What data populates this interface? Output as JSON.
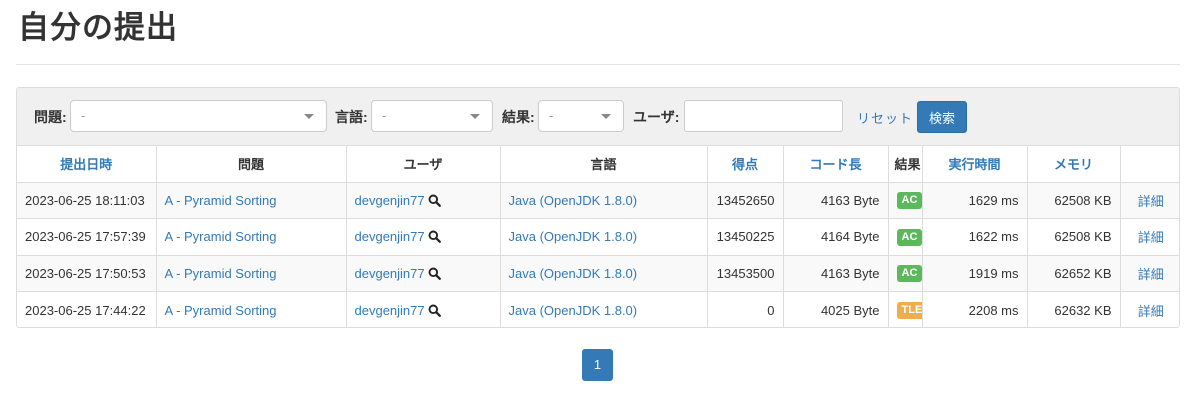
{
  "page": {
    "title": "自分の提出"
  },
  "filters": {
    "task_label": "問題:",
    "task_value": "-",
    "language_label": "言語:",
    "language_value": "-",
    "status_label": "結果:",
    "status_value": "-",
    "user_label": "ユーザ:",
    "user_value": "",
    "reset_label": "リセット",
    "search_label": "検索"
  },
  "table": {
    "headers": {
      "submit_time": "提出日時",
      "task": "問題",
      "user": "ユーザ",
      "language": "言語",
      "score": "得点",
      "code_length": "コード長",
      "status": "結果",
      "exec_time": "実行時間",
      "memory": "メモリ",
      "detail": ""
    },
    "rows": [
      {
        "submit_time": "2023-06-25 18:11:03",
        "task": "A - Pyramid Sorting",
        "user": "devgenjin77",
        "language": "Java (OpenJDK 1.8.0)",
        "score": "13452650",
        "code_length": "4163 Byte",
        "status": "AC",
        "exec_time": "1629 ms",
        "memory": "62508 KB",
        "detail": "詳細"
      },
      {
        "submit_time": "2023-06-25 17:57:39",
        "task": "A - Pyramid Sorting",
        "user": "devgenjin77",
        "language": "Java (OpenJDK 1.8.0)",
        "score": "13450225",
        "code_length": "4164 Byte",
        "status": "AC",
        "exec_time": "1622 ms",
        "memory": "62508 KB",
        "detail": "詳細"
      },
      {
        "submit_time": "2023-06-25 17:50:53",
        "task": "A - Pyramid Sorting",
        "user": "devgenjin77",
        "language": "Java (OpenJDK 1.8.0)",
        "score": "13453500",
        "code_length": "4163 Byte",
        "status": "AC",
        "exec_time": "1919 ms",
        "memory": "62652 KB",
        "detail": "詳細"
      },
      {
        "submit_time": "2023-06-25 17:44:22",
        "task": "A - Pyramid Sorting",
        "user": "devgenjin77",
        "language": "Java (OpenJDK 1.8.0)",
        "score": "0",
        "code_length": "4025 Byte",
        "status": "TLE",
        "exec_time": "2208 ms",
        "memory": "62632 KB",
        "detail": "詳細"
      }
    ]
  },
  "status_colors": {
    "AC": "#5cb85c",
    "TLE": "#f0ad4e"
  },
  "icons": {
    "user_search": "magnifier-icon",
    "select_caret": "caret-down-icon"
  },
  "pagination": {
    "current_page": "1"
  }
}
